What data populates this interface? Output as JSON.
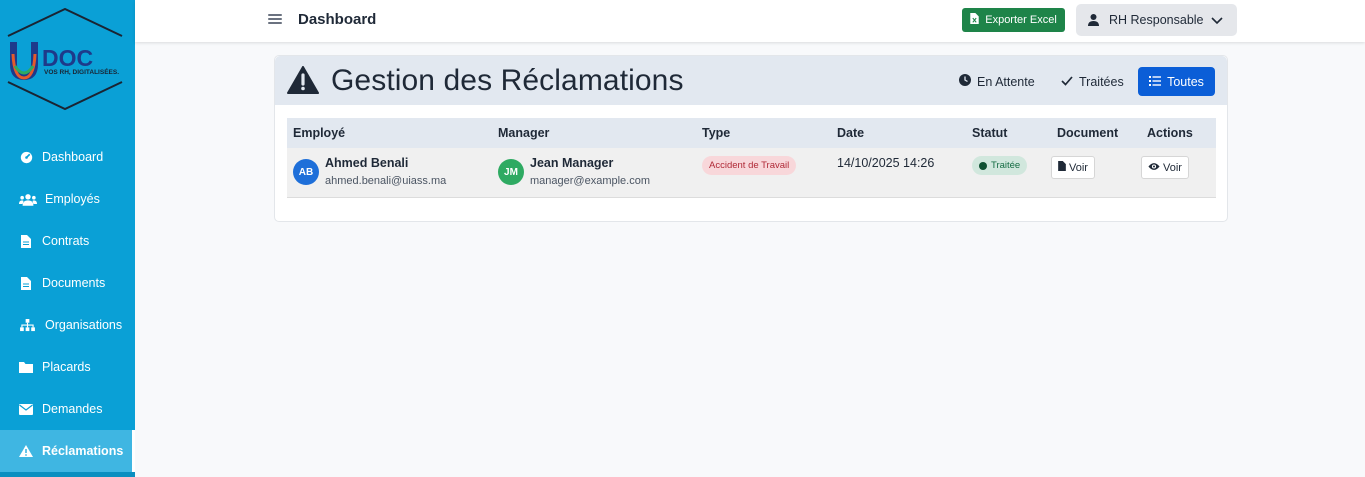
{
  "brand": {
    "logo_text": "DOC",
    "logo_letter": "U",
    "tagline": "VOS RH, DIGITALISÉES."
  },
  "sidebar": {
    "items": [
      {
        "label": "Dashboard",
        "icon": "dashboard-icon"
      },
      {
        "label": "Employés",
        "icon": "users-icon"
      },
      {
        "label": "Contrats",
        "icon": "file-icon"
      },
      {
        "label": "Documents",
        "icon": "file-icon"
      },
      {
        "label": "Organisations",
        "icon": "sitemap-icon"
      },
      {
        "label": "Placards",
        "icon": "folder-icon"
      },
      {
        "label": "Demandes",
        "icon": "envelope-icon"
      },
      {
        "label": "Réclamations",
        "icon": "warning-icon",
        "active": true
      }
    ]
  },
  "topbar": {
    "title": "Dashboard",
    "export_label": "Exporter Excel",
    "user_label": "RH Responsable"
  },
  "card": {
    "title": "Gestion des Réclamations",
    "filters": {
      "pending": "En Attente",
      "done": "Traitées",
      "all": "Toutes"
    },
    "active_filter": "all"
  },
  "table": {
    "headers": [
      "Employé",
      "Manager",
      "Type",
      "Date",
      "Statut",
      "Document",
      "Actions"
    ],
    "rows": [
      {
        "employee": {
          "initials": "AB",
          "name": "Ahmed Benali",
          "email": "ahmed.benali@uiass.ma"
        },
        "manager": {
          "initials": "JM",
          "name": "Jean Manager",
          "email": "manager@example.com"
        },
        "type": "Accident de Travail",
        "date": "14/10/2025 14:26",
        "status": "Traitée",
        "document_label": "Voir",
        "action_label": "Voir"
      }
    ]
  },
  "colors": {
    "sidebar": "#0aa0d6",
    "primary": "#0b5ed7",
    "excel": "#1e8449",
    "avatar_blue": "#1e6fd9",
    "avatar_green": "#2eaa62",
    "type_badge": "#f8d7da",
    "status_badge": "#d1e7dd"
  }
}
